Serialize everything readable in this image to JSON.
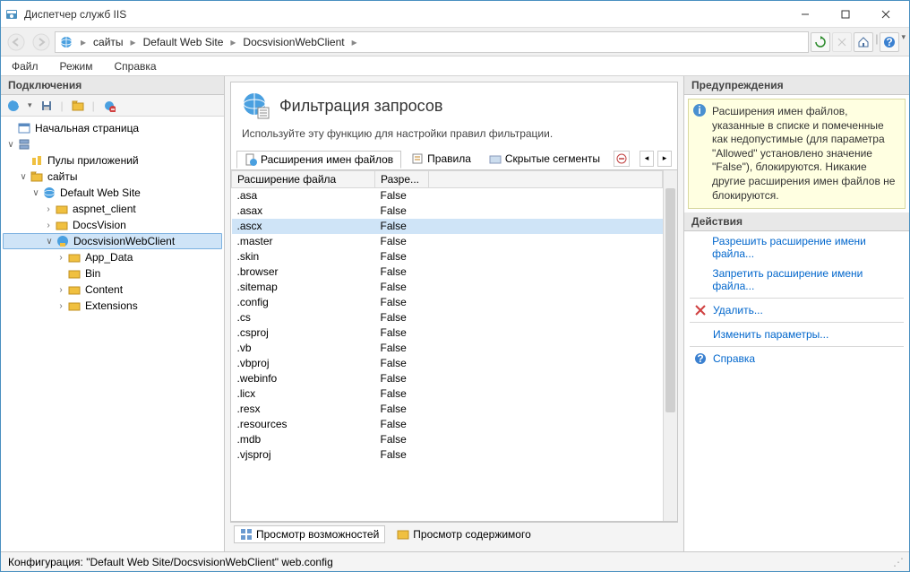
{
  "window": {
    "title": "Диспетчер служб IIS"
  },
  "address": {
    "root": "сайты",
    "crumbs": [
      "Default Web Site",
      "DocsvisionWebClient"
    ]
  },
  "menu": {
    "file": "Файл",
    "mode": "Режим",
    "help": "Справка"
  },
  "panels": {
    "left_title": "Подключения",
    "right_title_alerts": "Предупреждения",
    "right_title_actions": "Действия"
  },
  "tree": {
    "start": "Начальная страница",
    "apppools": "Пулы приложений",
    "sites": "сайты",
    "dws": "Default Web Site",
    "children": {
      "aspnet": "aspnet_client",
      "docsvision": "DocsVision",
      "webclient": "DocsvisionWebClient",
      "appdata": "App_Data",
      "bin": "Bin",
      "content": "Content",
      "extensions": "Extensions"
    }
  },
  "feature": {
    "title": "Фильтрация запросов",
    "desc": "Используйте эту функцию для настройки правил фильтрации."
  },
  "tabs": {
    "ext": "Расширения имен файлов",
    "rules": "Правила",
    "hidden": "Скрытые сегменты"
  },
  "grid": {
    "col_ext": "Расширение файла",
    "col_allowed": "Разре...",
    "rows": [
      {
        "ext": ".asa",
        "allowed": "False"
      },
      {
        "ext": ".asax",
        "allowed": "False"
      },
      {
        "ext": ".ascx",
        "allowed": "False",
        "selected": true
      },
      {
        "ext": ".master",
        "allowed": "False"
      },
      {
        "ext": ".skin",
        "allowed": "False"
      },
      {
        "ext": ".browser",
        "allowed": "False"
      },
      {
        "ext": ".sitemap",
        "allowed": "False"
      },
      {
        "ext": ".config",
        "allowed": "False"
      },
      {
        "ext": ".cs",
        "allowed": "False"
      },
      {
        "ext": ".csproj",
        "allowed": "False"
      },
      {
        "ext": ".vb",
        "allowed": "False"
      },
      {
        "ext": ".vbproj",
        "allowed": "False"
      },
      {
        "ext": ".webinfo",
        "allowed": "False"
      },
      {
        "ext": ".licx",
        "allowed": "False"
      },
      {
        "ext": ".resx",
        "allowed": "False"
      },
      {
        "ext": ".resources",
        "allowed": "False"
      },
      {
        "ext": ".mdb",
        "allowed": "False"
      },
      {
        "ext": ".vjsproj",
        "allowed": "False"
      }
    ]
  },
  "footer": {
    "features_view": "Просмотр возможностей",
    "content_view": "Просмотр содержимого"
  },
  "alert": {
    "text": "Расширения имен файлов, указанные в списке и помеченные как недопустимые (для параметра \"Allowed\" установлено значение \"False\"), блокируются. Никакие другие расширения имен файлов не блокируются."
  },
  "actions": {
    "allow": "Разрешить расширение имени файла...",
    "deny": "Запретить расширение имени файла...",
    "delete": "Удалить...",
    "edit": "Изменить параметры...",
    "help": "Справка"
  },
  "status": {
    "config": "Конфигурация: \"Default Web Site/DocsvisionWebClient\" web.config"
  }
}
